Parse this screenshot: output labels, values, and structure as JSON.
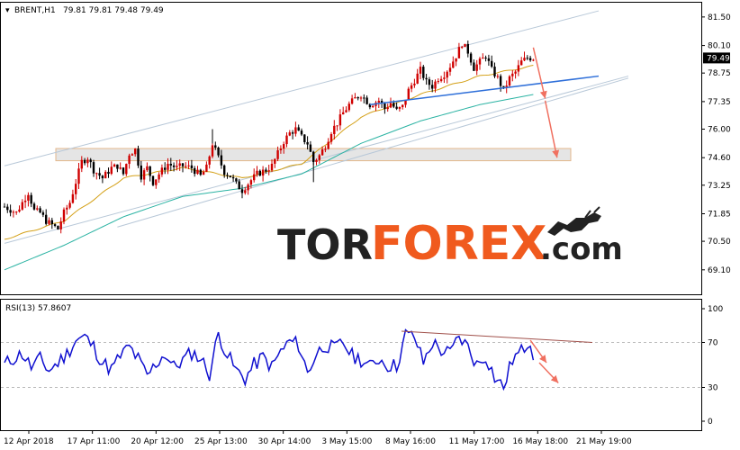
{
  "header": {
    "symbol": "BRENT,H1",
    "ohlc": "79.81 79.81 79.48 79.49",
    "rsi_label": "RSI(13) 57.8607"
  },
  "brand": {
    "part1": "TOR",
    "part2": "FOREX",
    "part3": ".com"
  },
  "colors": {
    "bull_candle": "#d00000",
    "bear_candle": "#000000",
    "ma_fast": "#d4a017",
    "ma_slow": "#2bb3a3",
    "channel": "#b8c8d8",
    "trendline_blue": "#2e6fd9",
    "rsi_line": "#1010d0",
    "rsi_trend": "#a0504a",
    "arrow": "#f07060",
    "zone_fill": "#e3e3e3",
    "zone_border": "#e0b080",
    "brand_orange": "#f05a1e"
  },
  "chart_data": [
    {
      "type": "candlestick",
      "title": "BRENT,H1",
      "current_price": "79.49",
      "y_ticks": [
        "81.50",
        "80.10",
        "78.75",
        "77.35",
        "76.00",
        "74.60",
        "73.25",
        "71.85",
        "70.50",
        "69.10"
      ],
      "ylim": [
        69.1,
        81.5
      ],
      "x_tick_labels": [
        "12 Apr 2018",
        "17 Apr 11:00",
        "20 Apr 12:00",
        "25 Apr 13:00",
        "30 Apr 14:00",
        "3 May 15:00",
        "8 May 16:00",
        "11 May 17:00",
        "16 May 18:00",
        "21 May 19:00"
      ],
      "price_anchors": [
        [
          0,
          72.2
        ],
        [
          4,
          71.9
        ],
        [
          8,
          72.9
        ],
        [
          10,
          72.0
        ],
        [
          12,
          71.9
        ],
        [
          14,
          71.5
        ],
        [
          16,
          71.3
        ],
        [
          18,
          71.1
        ],
        [
          20,
          71.9
        ],
        [
          22,
          72.4
        ],
        [
          24,
          73.4
        ],
        [
          26,
          74.4
        ],
        [
          28,
          74.6
        ],
        [
          30,
          74.0
        ],
        [
          33,
          73.6
        ],
        [
          36,
          74.1
        ],
        [
          38,
          74.2
        ],
        [
          40,
          73.8
        ],
        [
          42,
          74.8
        ],
        [
          44,
          75.0
        ],
        [
          46,
          73.7
        ],
        [
          48,
          74.1
        ],
        [
          50,
          73.4
        ],
        [
          52,
          73.8
        ],
        [
          55,
          74.3
        ],
        [
          58,
          74.1
        ],
        [
          60,
          74.2
        ],
        [
          63,
          74.1
        ],
        [
          66,
          73.7
        ],
        [
          68,
          74.1
        ],
        [
          70,
          75.3
        ],
        [
          72,
          74.6
        ],
        [
          74,
          73.9
        ],
        [
          76,
          73.7
        ],
        [
          78,
          73.3
        ],
        [
          80,
          73.0
        ],
        [
          83,
          73.5
        ],
        [
          85,
          73.8
        ],
        [
          88,
          74.0
        ],
        [
          90,
          74.2
        ],
        [
          92,
          74.8
        ],
        [
          94,
          75.4
        ],
        [
          96,
          75.8
        ],
        [
          98,
          76.0
        ],
        [
          100,
          75.6
        ],
        [
          102,
          75.3
        ],
        [
          104,
          74.4
        ],
        [
          106,
          74.7
        ],
        [
          108,
          75.2
        ],
        [
          110,
          75.9
        ],
        [
          112,
          76.3
        ],
        [
          114,
          76.8
        ],
        [
          116,
          77.2
        ],
        [
          118,
          77.5
        ],
        [
          120,
          77.7
        ],
        [
          123,
          77.2
        ],
        [
          126,
          77.4
        ],
        [
          128,
          77.0
        ],
        [
          130,
          77.3
        ],
        [
          132,
          76.9
        ],
        [
          134,
          77.1
        ],
        [
          136,
          77.9
        ],
        [
          138,
          78.4
        ],
        [
          140,
          78.9
        ],
        [
          142,
          78.3
        ],
        [
          144,
          78.1
        ],
        [
          146,
          78.5
        ],
        [
          148,
          78.7
        ],
        [
          150,
          79.1
        ],
        [
          152,
          79.6
        ],
        [
          154,
          80.2
        ],
        [
          156,
          79.8
        ],
        [
          158,
          79.0
        ],
        [
          160,
          79.3
        ],
        [
          162,
          79.6
        ],
        [
          164,
          78.9
        ],
        [
          166,
          78.5
        ],
        [
          168,
          77.9
        ],
        [
          170,
          78.5
        ],
        [
          172,
          78.8
        ],
        [
          174,
          79.3
        ],
        [
          176,
          79.5
        ],
        [
          178,
          79.49
        ]
      ],
      "ma_fast_anchors": [
        [
          0,
          70.6
        ],
        [
          20,
          71.5
        ],
        [
          40,
          73.6
        ],
        [
          60,
          74.1
        ],
        [
          80,
          73.6
        ],
        [
          100,
          74.3
        ],
        [
          120,
          76.6
        ],
        [
          140,
          77.7
        ],
        [
          160,
          78.6
        ],
        [
          178,
          79.1
        ]
      ],
      "ma_slow_anchors": [
        [
          0,
          69.1
        ],
        [
          20,
          70.3
        ],
        [
          40,
          71.7
        ],
        [
          60,
          72.7
        ],
        [
          80,
          73.1
        ],
        [
          100,
          73.8
        ],
        [
          120,
          75.3
        ],
        [
          140,
          76.4
        ],
        [
          160,
          77.2
        ],
        [
          178,
          77.7
        ]
      ],
      "channel_lines": [
        [
          [
            0,
            74.2
          ],
          [
            200,
            81.8
          ]
        ],
        [
          [
            0,
            70.4
          ],
          [
            210,
            78.6
          ]
        ],
        [
          [
            38,
            71.2
          ],
          [
            210,
            78.5
          ]
        ]
      ],
      "trend_line_blue": [
        [
          123,
          77.2
        ],
        [
          200,
          78.6
        ]
      ],
      "support_zone": [
        74.45,
        75.05
      ],
      "forecast_arrows": [
        [
          [
            178,
            80.0
          ],
          [
            182,
            77.5
          ]
        ],
        [
          [
            182,
            77.4
          ],
          [
            186,
            74.6
          ]
        ]
      ]
    },
    {
      "type": "line",
      "title": "RSI(13) 57.8607",
      "y_ticks": [
        "100",
        "70",
        "30",
        "0"
      ],
      "ylim": [
        0,
        100
      ],
      "levels": [
        70,
        30
      ],
      "rsi_anchors": [
        [
          0,
          50
        ],
        [
          3,
          56
        ],
        [
          6,
          60
        ],
        [
          9,
          48
        ],
        [
          12,
          55
        ],
        [
          15,
          45
        ],
        [
          18,
          52
        ],
        [
          21,
          60
        ],
        [
          24,
          72
        ],
        [
          27,
          75
        ],
        [
          30,
          66
        ],
        [
          33,
          52
        ],
        [
          36,
          46
        ],
        [
          39,
          58
        ],
        [
          42,
          66
        ],
        [
          45,
          55
        ],
        [
          48,
          40
        ],
        [
          51,
          51
        ],
        [
          54,
          60
        ],
        [
          57,
          48
        ],
        [
          60,
          54
        ],
        [
          63,
          61
        ],
        [
          66,
          56
        ],
        [
          69,
          42
        ],
        [
          72,
          78
        ],
        [
          75,
          59
        ],
        [
          78,
          45
        ],
        [
          81,
          38
        ],
        [
          84,
          50
        ],
        [
          87,
          57
        ],
        [
          90,
          48
        ],
        [
          93,
          62
        ],
        [
          96,
          71
        ],
        [
          99,
          68
        ],
        [
          102,
          43
        ],
        [
          105,
          60
        ],
        [
          108,
          68
        ],
        [
          111,
          64
        ],
        [
          114,
          70
        ],
        [
          117,
          58
        ],
        [
          120,
          55
        ],
        [
          123,
          48
        ],
        [
          126,
          56
        ],
        [
          129,
          50
        ],
        [
          132,
          49
        ],
        [
          135,
          77
        ],
        [
          138,
          75
        ],
        [
          141,
          52
        ],
        [
          144,
          70
        ],
        [
          147,
          63
        ],
        [
          150,
          60
        ],
        [
          153,
          75
        ],
        [
          156,
          66
        ],
        [
          159,
          50
        ],
        [
          162,
          58
        ],
        [
          165,
          39
        ],
        [
          168,
          30
        ],
        [
          171,
          55
        ],
        [
          174,
          62
        ],
        [
          177,
          73
        ],
        [
          178,
          57.9
        ]
      ],
      "rsi_trend_line": [
        [
          170,
          80
        ],
        [
          256,
          70
        ]
      ],
      "forecast_arrows": [
        [
          [
            177,
            72
          ],
          [
            180,
            52
          ]
        ],
        [
          [
            180,
            52
          ],
          [
            184,
            34
          ]
        ]
      ]
    }
  ]
}
